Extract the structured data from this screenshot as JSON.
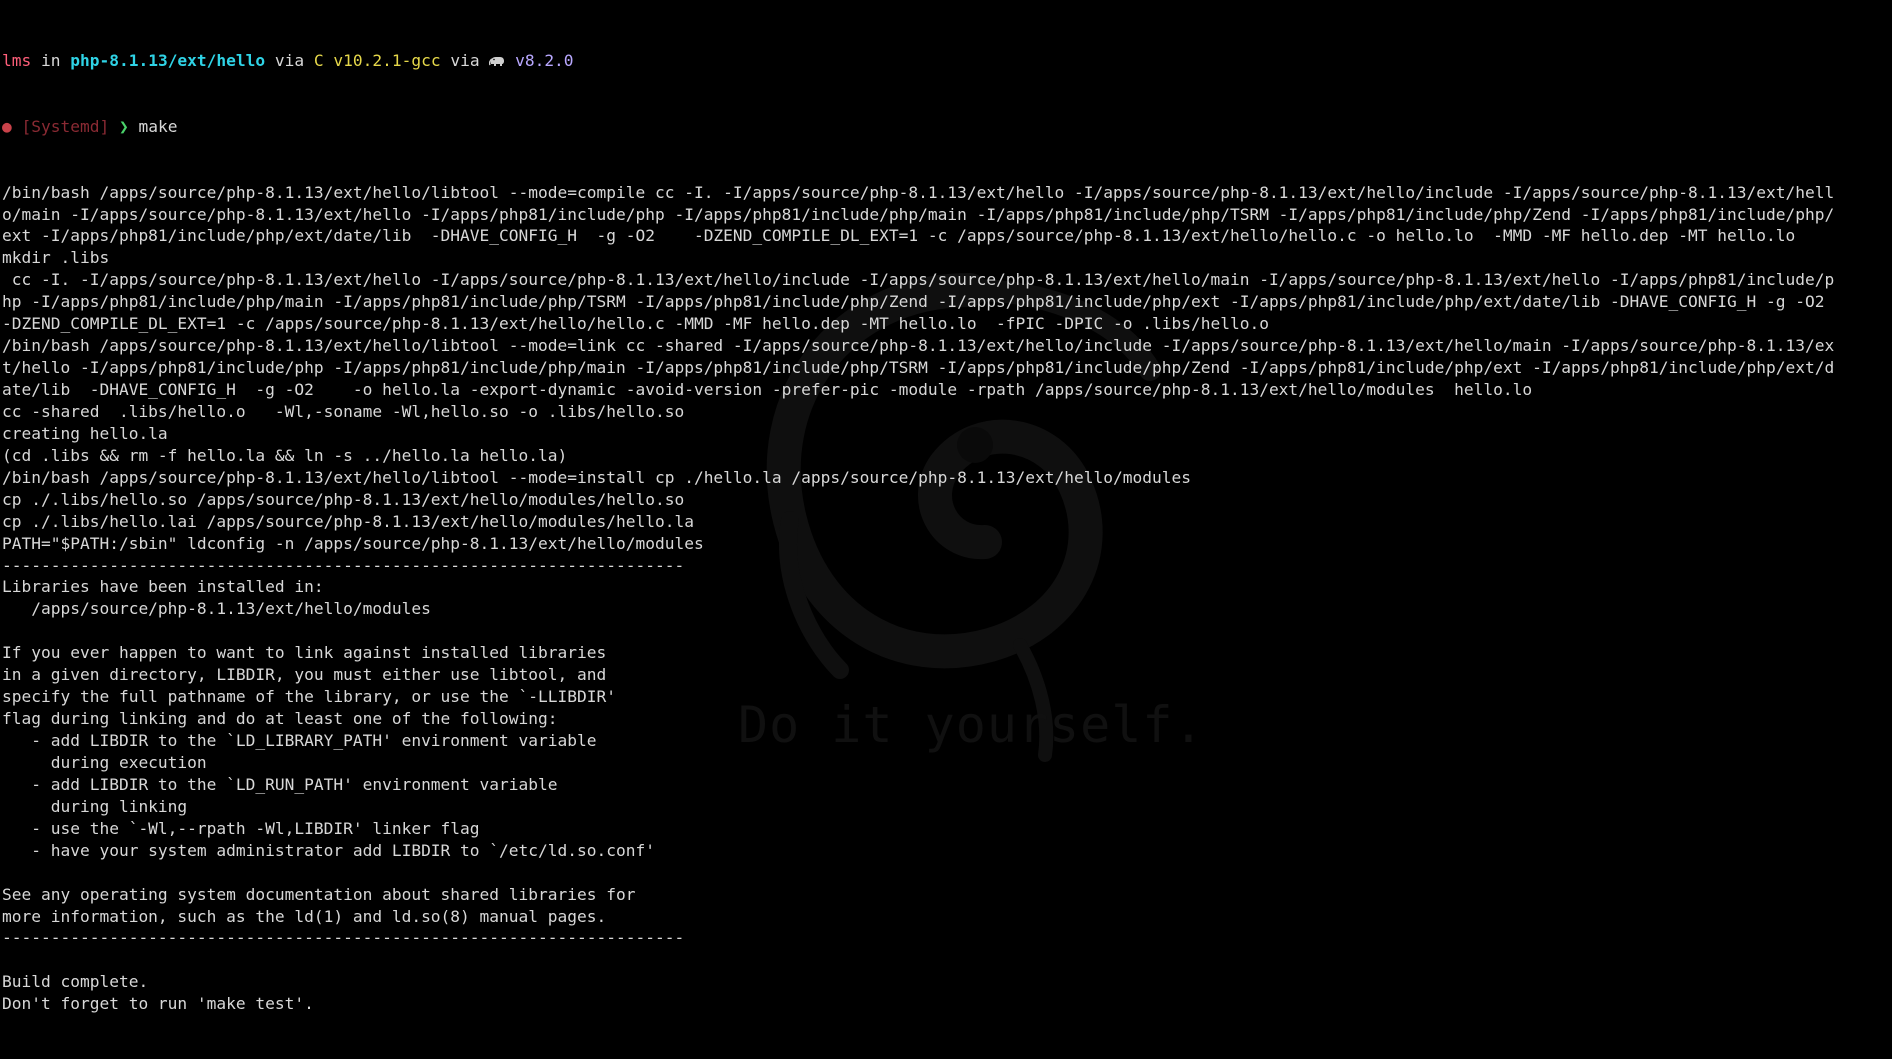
{
  "prompt": {
    "user": "lms",
    "in_word": " in ",
    "directory": "php-8.1.13/ext/hello",
    "via1": " via ",
    "c_lang": "C v10.2.1-gcc",
    "via2": " via ",
    "php_version": "v8.2.0",
    "status_dot": "●",
    "environment": "[Systemd]",
    "arrow": "❯",
    "command": "make"
  },
  "output_lines": [
    "/bin/bash /apps/source/php-8.1.13/ext/hello/libtool --mode=compile cc -I. -I/apps/source/php-8.1.13/ext/hello -I/apps/source/php-8.1.13/ext/hello/include -I/apps/source/php-8.1.13/ext/hell",
    "o/main -I/apps/source/php-8.1.13/ext/hello -I/apps/php81/include/php -I/apps/php81/include/php/main -I/apps/php81/include/php/TSRM -I/apps/php81/include/php/Zend -I/apps/php81/include/php/",
    "ext -I/apps/php81/include/php/ext/date/lib  -DHAVE_CONFIG_H  -g -O2    -DZEND_COMPILE_DL_EXT=1 -c /apps/source/php-8.1.13/ext/hello/hello.c -o hello.lo  -MMD -MF hello.dep -MT hello.lo",
    "mkdir .libs",
    " cc -I. -I/apps/source/php-8.1.13/ext/hello -I/apps/source/php-8.1.13/ext/hello/include -I/apps/source/php-8.1.13/ext/hello/main -I/apps/source/php-8.1.13/ext/hello -I/apps/php81/include/p",
    "hp -I/apps/php81/include/php/main -I/apps/php81/include/php/TSRM -I/apps/php81/include/php/Zend -I/apps/php81/include/php/ext -I/apps/php81/include/php/ext/date/lib -DHAVE_CONFIG_H -g -O2",
    "-DZEND_COMPILE_DL_EXT=1 -c /apps/source/php-8.1.13/ext/hello/hello.c -MMD -MF hello.dep -MT hello.lo  -fPIC -DPIC -o .libs/hello.o",
    "/bin/bash /apps/source/php-8.1.13/ext/hello/libtool --mode=link cc -shared -I/apps/source/php-8.1.13/ext/hello/include -I/apps/source/php-8.1.13/ext/hello/main -I/apps/source/php-8.1.13/ex",
    "t/hello -I/apps/php81/include/php -I/apps/php81/include/php/main -I/apps/php81/include/php/TSRM -I/apps/php81/include/php/Zend -I/apps/php81/include/php/ext -I/apps/php81/include/php/ext/d",
    "ate/lib  -DHAVE_CONFIG_H  -g -O2    -o hello.la -export-dynamic -avoid-version -prefer-pic -module -rpath /apps/source/php-8.1.13/ext/hello/modules  hello.lo",
    "cc -shared  .libs/hello.o   -Wl,-soname -Wl,hello.so -o .libs/hello.so",
    "creating hello.la",
    "(cd .libs && rm -f hello.la && ln -s ../hello.la hello.la)",
    "/bin/bash /apps/source/php-8.1.13/ext/hello/libtool --mode=install cp ./hello.la /apps/source/php-8.1.13/ext/hello/modules",
    "cp ./.libs/hello.so /apps/source/php-8.1.13/ext/hello/modules/hello.so",
    "cp ./.libs/hello.lai /apps/source/php-8.1.13/ext/hello/modules/hello.la",
    "PATH=\"$PATH:/sbin\" ldconfig -n /apps/source/php-8.1.13/ext/hello/modules",
    "----------------------------------------------------------------------",
    "Libraries have been installed in:",
    "   /apps/source/php-8.1.13/ext/hello/modules",
    "",
    "If you ever happen to want to link against installed libraries",
    "in a given directory, LIBDIR, you must either use libtool, and",
    "specify the full pathname of the library, or use the `-LLIBDIR'",
    "flag during linking and do at least one of the following:",
    "   - add LIBDIR to the `LD_LIBRARY_PATH' environment variable",
    "     during execution",
    "   - add LIBDIR to the `LD_RUN_PATH' environment variable",
    "     during linking",
    "   - use the `-Wl,--rpath -Wl,LIBDIR' linker flag",
    "   - have your system administrator add LIBDIR to `/etc/ld.so.conf'",
    "",
    "See any operating system documentation about shared libraries for",
    "more information, such as the ld(1) and ld.so(8) manual pages.",
    "----------------------------------------------------------------------",
    "",
    "Build complete.",
    "Don't forget to run 'make test'."
  ],
  "wallpaper": {
    "tagline": "Do it yourself.",
    "logo_icon": "debian-swirl-icon"
  },
  "colors": {
    "background": "#000000",
    "text": "#d8d8d8",
    "user": "#ff5f7a",
    "directory": "#2fd3e6",
    "c_lang": "#e6d84a",
    "php": "#b9a8ff",
    "prompt_arrow": "#4ad26a"
  }
}
